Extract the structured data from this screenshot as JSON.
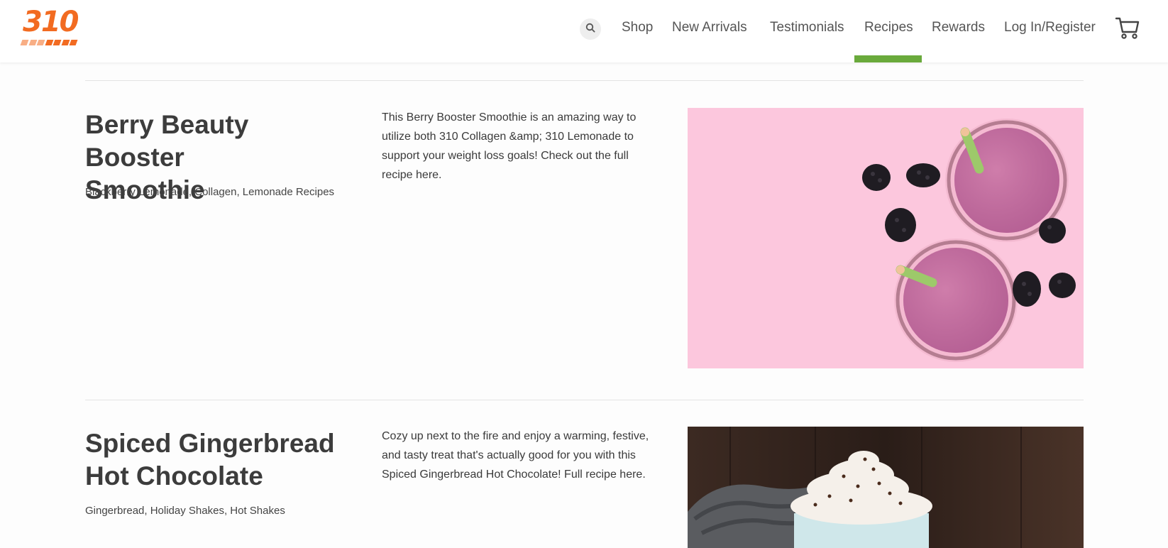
{
  "brand": {
    "logo_text": "310",
    "accent": "#f26b21",
    "active_color": "#6aaa3c"
  },
  "nav": {
    "search_icon": "search-icon",
    "items": [
      "Shop",
      "New Arrivals",
      "Testimonials",
      "Recipes",
      "Rewards",
      "Log In/Register"
    ],
    "active": "Recipes",
    "cart_icon": "cart-icon"
  },
  "recipes": [
    {
      "title_line1": "Berry Beauty Booster",
      "title_line2": "Smoothie",
      "tags": "Blackberry Lemonade, Collagen, Lemonade Recipes",
      "description": "This Berry Booster Smoothie is an amazing way to utilize both 310 Collagen &amp; 310 Lemonade to support your weight loss goals! Check out the full recipe here.",
      "image": "berry-smoothie-photo"
    },
    {
      "title_line1": "Spiced Gingerbread",
      "title_line2": "Hot Chocolate",
      "tags": "Gingerbread, Holiday Shakes, Hot Shakes",
      "description": "Cozy up next to the fire and enjoy a warming, festive, and tasty treat that's actually good for you with this Spiced Gingerbread Hot Chocolate! Full recipe here.",
      "image": "hot-chocolate-photo"
    }
  ]
}
